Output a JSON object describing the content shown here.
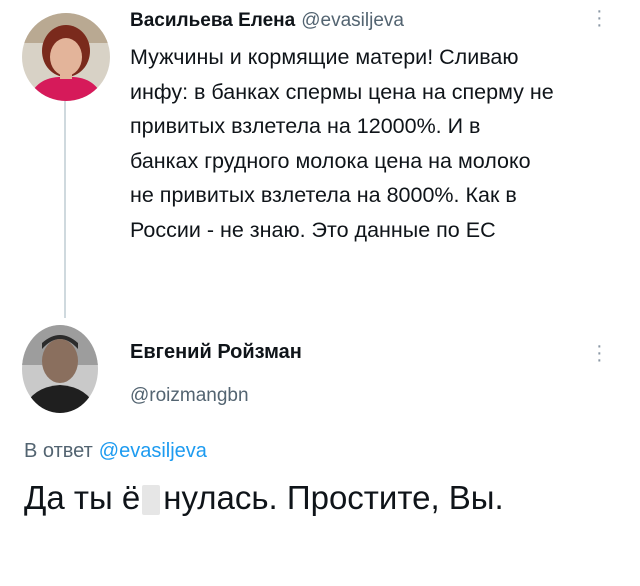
{
  "tweet1": {
    "author_name": "Васильева Елена",
    "handle": "@evasiljeva",
    "text_lines": [
      "Мужчины и кормящие матери! Сливаю",
      "инфу: в банках спермы цена на сперму не",
      "привитых взлетела на 12000%. И в",
      "банках грудного молока цена на молоко",
      "не привитых взлетела на 8000%. Как в",
      "России - не знаю. Это данные по ЕС"
    ]
  },
  "tweet2": {
    "author_name": "Евгений Ройзман",
    "handle": "@roizmangbn",
    "reply_prefix": "В ответ",
    "reply_mention": "@evasiljeva",
    "text_before": "Да ты ё",
    "text_after": "нулась. Простите, Вы."
  },
  "icons": {
    "more": "more-options-icon"
  },
  "colors": {
    "text": "#0f1419",
    "secondary": "#536471",
    "link": "#1d9bf0",
    "thread_line": "#cfd9de"
  }
}
